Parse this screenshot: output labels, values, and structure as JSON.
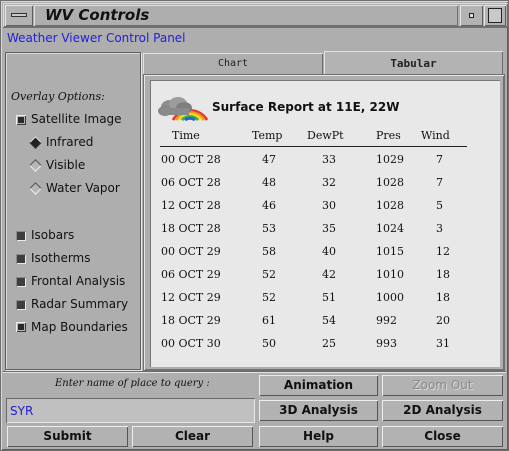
{
  "window": {
    "title": "WV Controls"
  },
  "panel_label": "Weather Viewer Control Panel",
  "overlay": {
    "title": "Overlay Options:",
    "satellite": {
      "label": "Satellite Image",
      "checked": true
    },
    "satellite_types": [
      {
        "label": "Infrared",
        "selected": true
      },
      {
        "label": "Visible",
        "selected": false
      },
      {
        "label": "Water Vapor",
        "selected": false
      }
    ],
    "others": [
      {
        "label": "Isobars",
        "checked": false
      },
      {
        "label": "Isotherms",
        "checked": false
      },
      {
        "label": "Frontal Analysis",
        "checked": false
      },
      {
        "label": "Radar Summary",
        "checked": false
      },
      {
        "label": "Map Boundaries",
        "checked": true
      }
    ]
  },
  "tabs": [
    {
      "label": "Chart",
      "active": false
    },
    {
      "label": "Tabular",
      "active": true
    }
  ],
  "report": {
    "title": "Surface Report at 11E, 22W",
    "columns": [
      "Time",
      "Temp",
      "DewPt",
      "Pres",
      "Wind"
    ],
    "rows": [
      [
        "00 OCT 28",
        "47",
        "33",
        "1029",
        "7"
      ],
      [
        "06 OCT 28",
        "48",
        "32",
        "1028",
        "7"
      ],
      [
        "12 OCT 28",
        "46",
        "30",
        "1028",
        "5"
      ],
      [
        "18 OCT 28",
        "53",
        "35",
        "1024",
        "3"
      ],
      [
        "00 OCT 29",
        "58",
        "40",
        "1015",
        "12"
      ],
      [
        "06 OCT 29",
        "52",
        "42",
        "1010",
        "18"
      ],
      [
        "12 OCT 29",
        "52",
        "51",
        "1000",
        "18"
      ],
      [
        "18 OCT 29",
        "61",
        "54",
        "992",
        "20"
      ],
      [
        "00 OCT 30",
        "50",
        "25",
        "993",
        "31"
      ]
    ]
  },
  "query": {
    "label": "Enter name of place to query :",
    "value": "SYR"
  },
  "buttons": {
    "animation": "Animation",
    "zoom_out": "Zoom Out",
    "analysis_3d": "3D Analysis",
    "analysis_2d": "2D Analysis",
    "submit": "Submit",
    "clear": "Clear",
    "help": "Help",
    "close": "Close"
  }
}
